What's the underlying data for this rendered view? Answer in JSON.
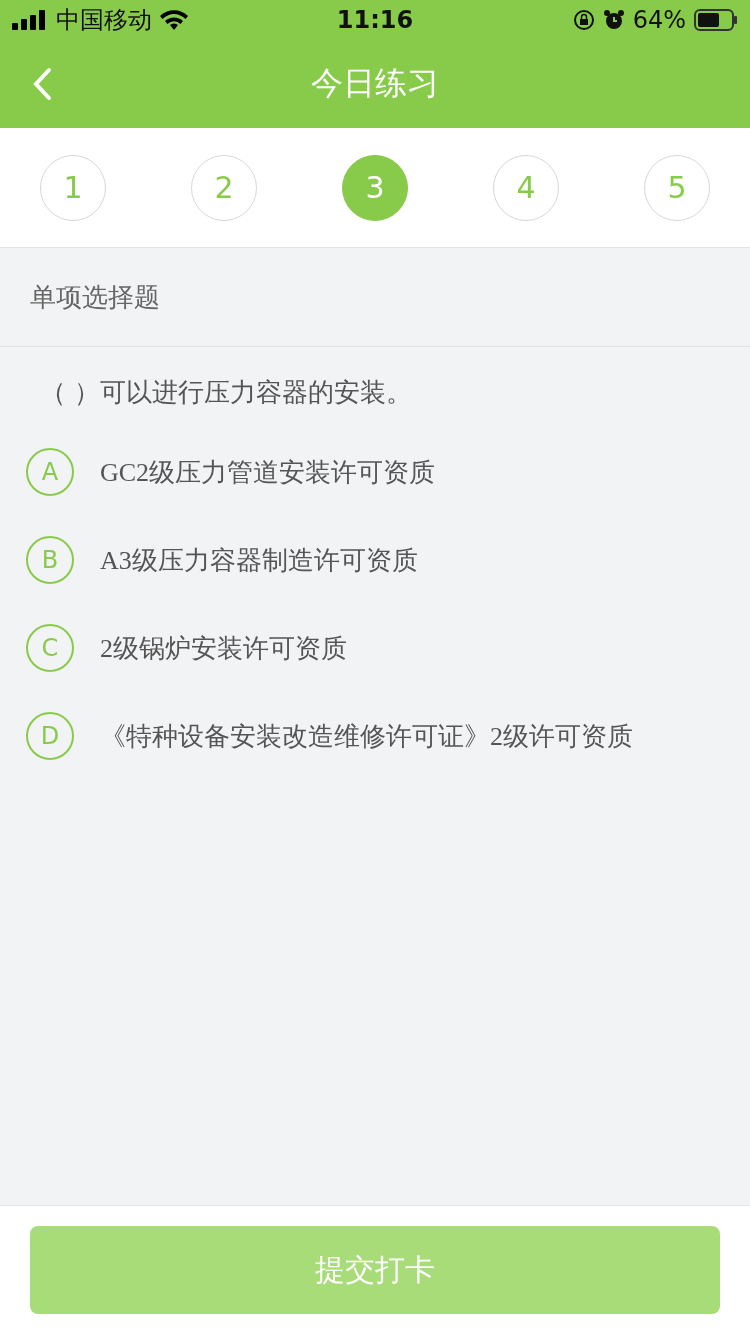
{
  "status_bar": {
    "carrier": "中国移动",
    "time": "11:16",
    "battery": "64%"
  },
  "nav": {
    "title": "今日练习"
  },
  "steps": [
    {
      "label": "1",
      "selected": false
    },
    {
      "label": "2",
      "selected": false
    },
    {
      "label": "3",
      "selected": true
    },
    {
      "label": "4",
      "selected": false
    },
    {
      "label": "5",
      "selected": false
    }
  ],
  "section": {
    "title": "单项选择题"
  },
  "question": {
    "text": "（    ）可以进行压力容器的安装。",
    "options": [
      {
        "letter": "A",
        "text": "GC2级压力管道安装许可资质",
        "selected": false
      },
      {
        "letter": "B",
        "text": "A3级压力容器制造许可资质",
        "selected": false
      },
      {
        "letter": "C",
        "text": "2级锅炉安装许可资质",
        "selected": false
      },
      {
        "letter": "D",
        "text": "《特种设备安装改造维修许可证》2级许可资质",
        "selected": false
      }
    ]
  },
  "submit": {
    "label": "提交打卡",
    "disabled": true
  }
}
